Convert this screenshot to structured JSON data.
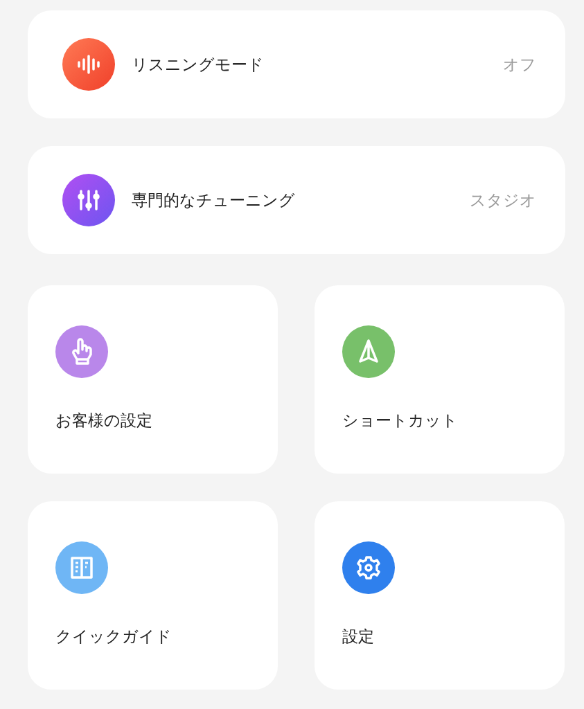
{
  "rows": [
    {
      "label": "リスニングモード",
      "value": "オフ"
    },
    {
      "label": "専門的なチューニング",
      "value": "スタジオ"
    }
  ],
  "tiles": [
    {
      "label": "お客様の設定"
    },
    {
      "label": "ショートカット"
    },
    {
      "label": "クイックガイド"
    },
    {
      "label": "設定"
    }
  ]
}
